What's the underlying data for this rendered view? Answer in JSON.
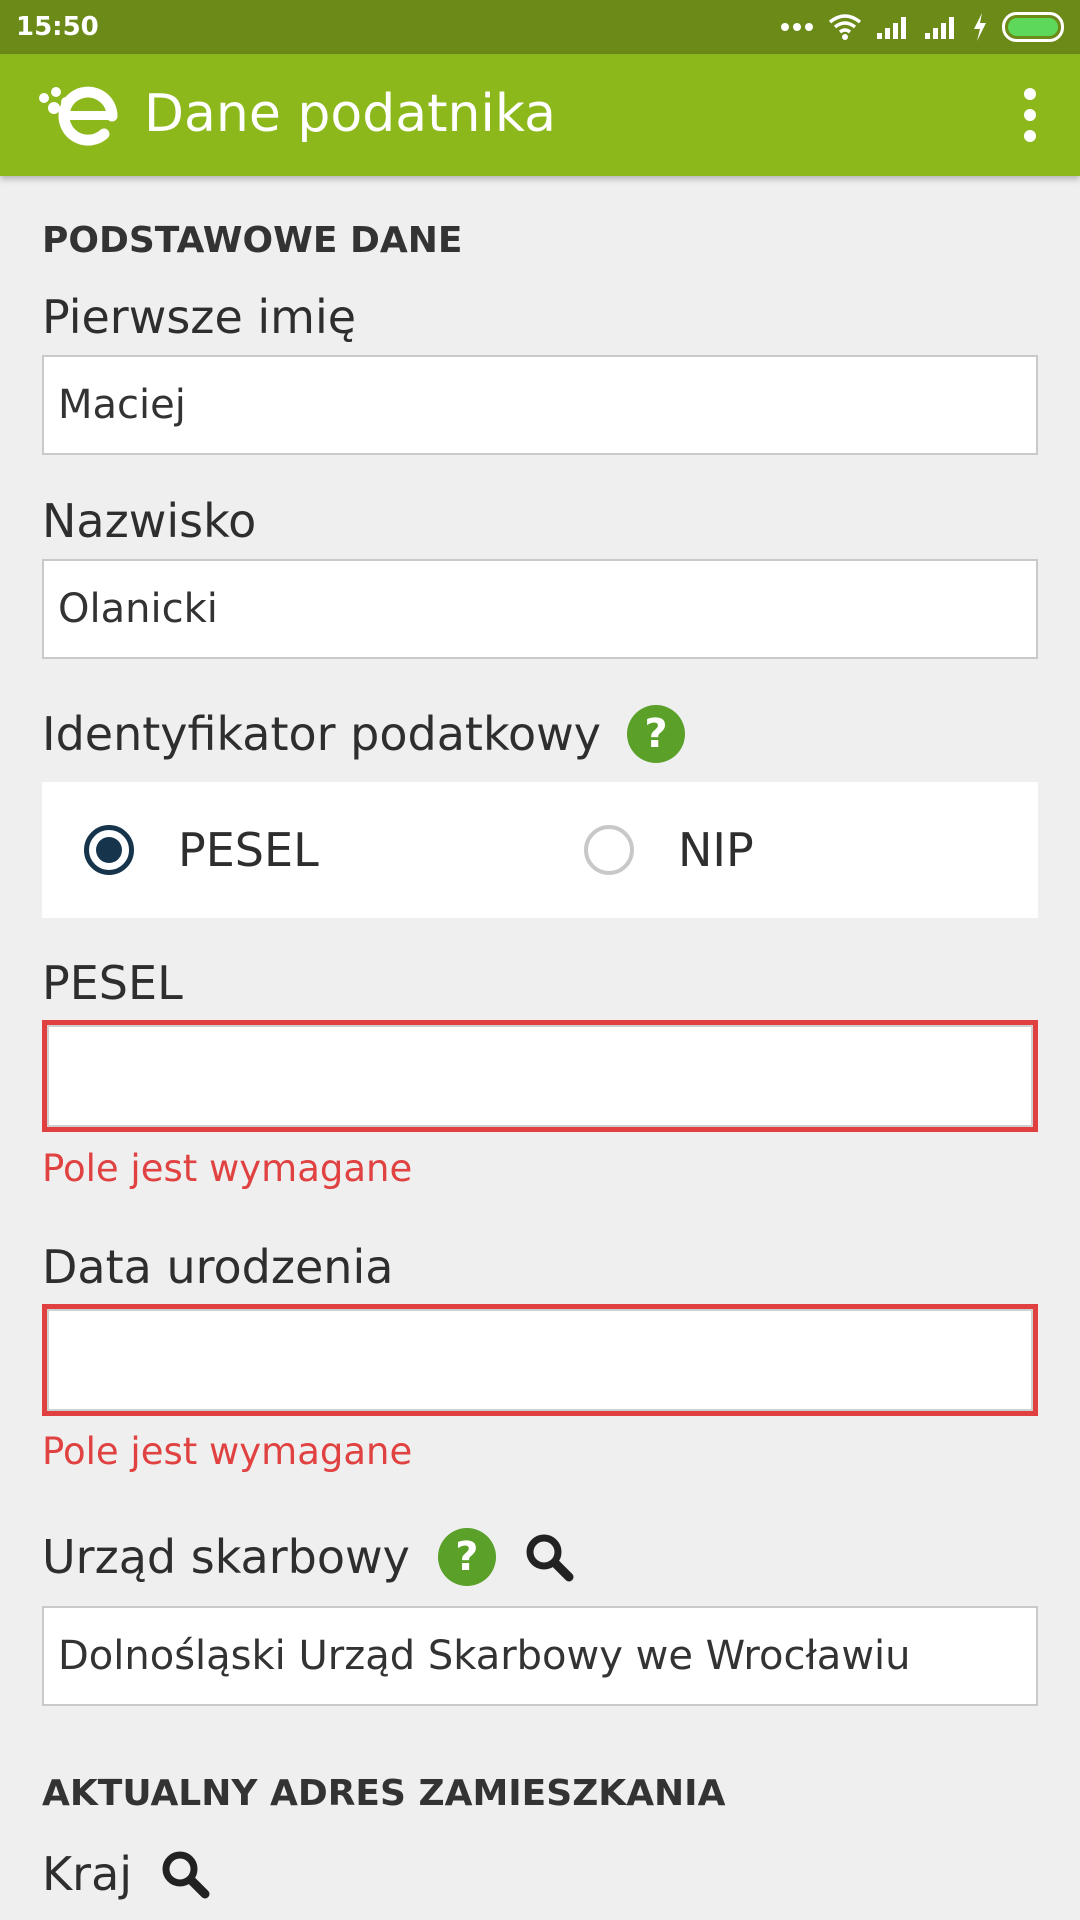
{
  "status_bar": {
    "time": "15:50"
  },
  "app_bar": {
    "title": "Dane podatnika"
  },
  "sections": {
    "basic": "PODSTAWOWE DANE",
    "address": "AKTUALNY ADRES ZAMIESZKANIA"
  },
  "fields": {
    "first_name": {
      "label": "Pierwsze imię",
      "value": "Maciej"
    },
    "last_name": {
      "label": "Nazwisko",
      "value": "Olanicki"
    },
    "tax_id": {
      "label": "Identyfikator podatkowy",
      "help": "?"
    },
    "pesel": {
      "label": "PESEL",
      "value": "",
      "error": "Pole jest wymagane"
    },
    "birth_date": {
      "label": "Data urodzenia",
      "value": "",
      "error": "Pole jest wymagane"
    },
    "tax_office": {
      "label": "Urząd skarbowy",
      "help": "?",
      "value": "Dolnośląski Urząd Skarbowy we Wrocławiu"
    },
    "country": {
      "label": "Kraj"
    }
  },
  "radio": {
    "options": [
      {
        "label": "PESEL",
        "checked": true
      },
      {
        "label": "NIP",
        "checked": false
      }
    ]
  },
  "colors": {
    "status_bar": "#6c8a17",
    "app_bar": "#8cb81c",
    "help": "#5aa029",
    "error": "#e04242",
    "radio_checked": "#16354d"
  }
}
